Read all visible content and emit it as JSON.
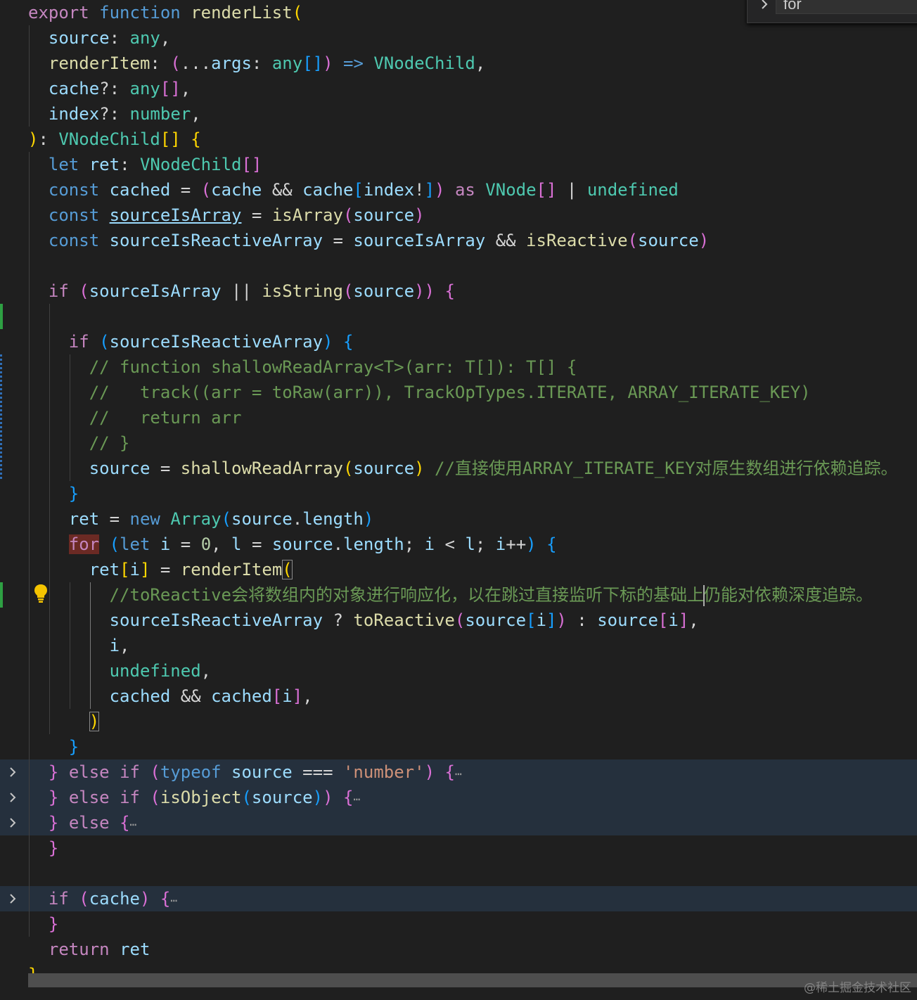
{
  "find_widget": {
    "value": "for"
  },
  "watermark": "@稀土掘金技术社区",
  "lines": [
    [
      [
        "kw",
        "export"
      ],
      [
        "pl",
        " "
      ],
      [
        "kwb",
        "function"
      ],
      [
        "pl",
        " "
      ],
      [
        "fn",
        "renderList"
      ],
      [
        "b1",
        "("
      ]
    ],
    [
      [
        "pl",
        "  "
      ],
      [
        "var",
        "source"
      ],
      [
        "pl",
        ": "
      ],
      [
        "typ",
        "any"
      ],
      [
        "pl",
        ","
      ]
    ],
    [
      [
        "pl",
        "  "
      ],
      [
        "fn",
        "renderItem"
      ],
      [
        "pl",
        ": "
      ],
      [
        "b2",
        "("
      ],
      [
        "pl",
        "..."
      ],
      [
        "var",
        "args"
      ],
      [
        "pl",
        ": "
      ],
      [
        "typ",
        "any"
      ],
      [
        "b3",
        "[]"
      ],
      [
        "b2",
        ")"
      ],
      [
        "pl",
        " "
      ],
      [
        "kwb",
        "=>"
      ],
      [
        "pl",
        " "
      ],
      [
        "typ",
        "VNodeChild"
      ],
      [
        "pl",
        ","
      ]
    ],
    [
      [
        "pl",
        "  "
      ],
      [
        "var",
        "cache"
      ],
      [
        "pl",
        "?: "
      ],
      [
        "typ",
        "any"
      ],
      [
        "b2",
        "[]"
      ],
      [
        "pl",
        ","
      ]
    ],
    [
      [
        "pl",
        "  "
      ],
      [
        "var",
        "index"
      ],
      [
        "pl",
        "?: "
      ],
      [
        "typ",
        "number"
      ],
      [
        "pl",
        ","
      ]
    ],
    [
      [
        "b1",
        ")"
      ],
      [
        "pl",
        ": "
      ],
      [
        "typ",
        "VNodeChild"
      ],
      [
        "b1",
        "[]"
      ],
      [
        "pl",
        " "
      ],
      [
        "b1",
        "{"
      ]
    ],
    [
      [
        "pl",
        "  "
      ],
      [
        "kwb",
        "let"
      ],
      [
        "pl",
        " "
      ],
      [
        "var",
        "ret"
      ],
      [
        "pl",
        ": "
      ],
      [
        "typ",
        "VNodeChild"
      ],
      [
        "b2",
        "[]"
      ]
    ],
    [
      [
        "pl",
        "  "
      ],
      [
        "kwb",
        "const"
      ],
      [
        "pl",
        " "
      ],
      [
        "var",
        "cached"
      ],
      [
        "pl",
        " = "
      ],
      [
        "b2",
        "("
      ],
      [
        "var",
        "cache"
      ],
      [
        "pl",
        " && "
      ],
      [
        "var",
        "cache"
      ],
      [
        "b3",
        "["
      ],
      [
        "var",
        "index"
      ],
      [
        "pl",
        "!"
      ],
      [
        "b3",
        "]"
      ],
      [
        "b2",
        ")"
      ],
      [
        "pl",
        " "
      ],
      [
        "kw",
        "as"
      ],
      [
        "pl",
        " "
      ],
      [
        "typ",
        "VNode"
      ],
      [
        "b2",
        "[]"
      ],
      [
        "pl",
        " | "
      ],
      [
        "typ",
        "undefined"
      ]
    ],
    [
      [
        "pl",
        "  "
      ],
      [
        "kwb",
        "const"
      ],
      [
        "pl",
        " "
      ],
      [
        "var ul",
        "sourceIsArray"
      ],
      [
        "pl",
        " = "
      ],
      [
        "fn",
        "isArray"
      ],
      [
        "b2",
        "("
      ],
      [
        "var",
        "source"
      ],
      [
        "b2",
        ")"
      ]
    ],
    [
      [
        "pl",
        "  "
      ],
      [
        "kwb",
        "const"
      ],
      [
        "pl",
        " "
      ],
      [
        "var",
        "sourceIsReactiveArray"
      ],
      [
        "pl",
        " = "
      ],
      [
        "var",
        "sourceIsArray"
      ],
      [
        "pl",
        " && "
      ],
      [
        "fn",
        "isReactive"
      ],
      [
        "b2",
        "("
      ],
      [
        "var",
        "source"
      ],
      [
        "b2",
        ")"
      ]
    ],
    [],
    [
      [
        "pl",
        "  "
      ],
      [
        "kw",
        "if"
      ],
      [
        "pl",
        " "
      ],
      [
        "b2",
        "("
      ],
      [
        "var",
        "sourceIsArray"
      ],
      [
        "pl",
        " || "
      ],
      [
        "fn",
        "isString"
      ],
      [
        "b2",
        "("
      ],
      [
        "var",
        "source"
      ],
      [
        "b2",
        "))"
      ],
      [
        "pl",
        " "
      ],
      [
        "b2",
        "{"
      ]
    ],
    [],
    [
      [
        "pl",
        "    "
      ],
      [
        "kw",
        "if"
      ],
      [
        "pl",
        " "
      ],
      [
        "b3",
        "("
      ],
      [
        "var",
        "sourceIsReactiveArray"
      ],
      [
        "b3",
        ")"
      ],
      [
        "pl",
        " "
      ],
      [
        "b3",
        "{"
      ]
    ],
    [
      [
        "pl",
        "      "
      ],
      [
        "cmt",
        "// function shallowReadArray<T>(arr: T[]): T[] {"
      ]
    ],
    [
      [
        "pl",
        "      "
      ],
      [
        "cmt",
        "//   track((arr = toRaw(arr)), TrackOpTypes.ITERATE, ARRAY_ITERATE_KEY)"
      ]
    ],
    [
      [
        "pl",
        "      "
      ],
      [
        "cmt",
        "//   return arr"
      ]
    ],
    [
      [
        "pl",
        "      "
      ],
      [
        "cmt",
        "// }"
      ]
    ],
    [
      [
        "pl",
        "      "
      ],
      [
        "var",
        "source"
      ],
      [
        "pl",
        " = "
      ],
      [
        "fn",
        "shallowReadArray"
      ],
      [
        "b1",
        "("
      ],
      [
        "var",
        "source"
      ],
      [
        "b1",
        ")"
      ],
      [
        "pl",
        " "
      ],
      [
        "cmt",
        "//直接使用ARRAY_ITERATE_KEY对原生数组进行依赖追踪。"
      ]
    ],
    [
      [
        "pl",
        "    "
      ],
      [
        "b3",
        "}"
      ]
    ],
    [
      [
        "pl",
        "    "
      ],
      [
        "var",
        "ret"
      ],
      [
        "pl",
        " = "
      ],
      [
        "kwb",
        "new"
      ],
      [
        "pl",
        " "
      ],
      [
        "typ",
        "Array"
      ],
      [
        "b3",
        "("
      ],
      [
        "var",
        "source"
      ],
      [
        "pl",
        "."
      ],
      [
        "var",
        "length"
      ],
      [
        "b3",
        ")"
      ]
    ],
    [
      [
        "pl",
        "    "
      ],
      [
        "kw hl-for",
        "for"
      ],
      [
        "pl",
        " "
      ],
      [
        "b3",
        "("
      ],
      [
        "kwb",
        "let"
      ],
      [
        "pl",
        " "
      ],
      [
        "var",
        "i"
      ],
      [
        "pl",
        " = "
      ],
      [
        "num",
        "0"
      ],
      [
        "pl",
        ", "
      ],
      [
        "var",
        "l"
      ],
      [
        "pl",
        " = "
      ],
      [
        "var",
        "source"
      ],
      [
        "pl",
        "."
      ],
      [
        "var",
        "length"
      ],
      [
        "pl",
        "; "
      ],
      [
        "var",
        "i"
      ],
      [
        "pl",
        " < "
      ],
      [
        "var",
        "l"
      ],
      [
        "pl",
        "; "
      ],
      [
        "var",
        "i"
      ],
      [
        "pl",
        "++"
      ],
      [
        "b3",
        ")"
      ],
      [
        "pl",
        " "
      ],
      [
        "b3",
        "{"
      ]
    ],
    [
      [
        "pl",
        "      "
      ],
      [
        "var",
        "ret"
      ],
      [
        "b1",
        "["
      ],
      [
        "var",
        "i"
      ],
      [
        "b1",
        "]"
      ],
      [
        "pl",
        " = "
      ],
      [
        "fn",
        "renderItem"
      ],
      [
        "b1 bracket-box",
        "("
      ]
    ],
    [
      [
        "pl",
        "        "
      ],
      [
        "cmt",
        "//toReactive会将数组内的对象进行响应化，以在跳过直接监听下标的基础上"
      ],
      [
        "caret",
        ""
      ],
      [
        "cmt",
        "仍能对依赖深度追踪。"
      ]
    ],
    [
      [
        "pl",
        "        "
      ],
      [
        "var",
        "sourceIsReactiveArray"
      ],
      [
        "pl",
        " ? "
      ],
      [
        "fn",
        "toReactive"
      ],
      [
        "b2",
        "("
      ],
      [
        "var",
        "source"
      ],
      [
        "b3",
        "["
      ],
      [
        "var",
        "i"
      ],
      [
        "b3",
        "]"
      ],
      [
        "b2",
        ")"
      ],
      [
        "pl",
        " : "
      ],
      [
        "var",
        "source"
      ],
      [
        "b2",
        "["
      ],
      [
        "var",
        "i"
      ],
      [
        "b2",
        "]"
      ],
      [
        "pl",
        ","
      ]
    ],
    [
      [
        "pl",
        "        "
      ],
      [
        "var",
        "i"
      ],
      [
        "pl",
        ","
      ]
    ],
    [
      [
        "pl",
        "        "
      ],
      [
        "typ",
        "undefined"
      ],
      [
        "pl",
        ","
      ]
    ],
    [
      [
        "pl",
        "        "
      ],
      [
        "var",
        "cached"
      ],
      [
        "pl",
        " && "
      ],
      [
        "var",
        "cached"
      ],
      [
        "b2",
        "["
      ],
      [
        "var",
        "i"
      ],
      [
        "b2",
        "]"
      ],
      [
        "pl",
        ","
      ]
    ],
    [
      [
        "pl",
        "      "
      ],
      [
        "b1 bracket-box",
        ")"
      ]
    ],
    [
      [
        "pl",
        "    "
      ],
      [
        "b3",
        "}"
      ]
    ],
    [
      [
        "pl",
        "  "
      ],
      [
        "b2",
        "}"
      ],
      [
        "pl",
        " "
      ],
      [
        "kw",
        "else"
      ],
      [
        "pl",
        " "
      ],
      [
        "kw",
        "if"
      ],
      [
        "pl",
        " "
      ],
      [
        "b2",
        "("
      ],
      [
        "kwb",
        "typeof"
      ],
      [
        "pl",
        " "
      ],
      [
        "var",
        "source"
      ],
      [
        "pl",
        " === "
      ],
      [
        "str",
        "'number'"
      ],
      [
        "b2",
        ")"
      ],
      [
        "pl",
        " "
      ],
      [
        "b2",
        "{"
      ],
      [
        "ell",
        "⋯"
      ]
    ],
    [
      [
        "pl",
        "  "
      ],
      [
        "b2",
        "}"
      ],
      [
        "pl",
        " "
      ],
      [
        "kw",
        "else"
      ],
      [
        "pl",
        " "
      ],
      [
        "kw",
        "if"
      ],
      [
        "pl",
        " "
      ],
      [
        "b2",
        "("
      ],
      [
        "fn",
        "isObject"
      ],
      [
        "b3",
        "("
      ],
      [
        "var",
        "source"
      ],
      [
        "b3",
        ")"
      ],
      [
        "b2",
        ")"
      ],
      [
        "pl",
        " "
      ],
      [
        "b2",
        "{"
      ],
      [
        "ell",
        "⋯"
      ]
    ],
    [
      [
        "pl",
        "  "
      ],
      [
        "b2",
        "}"
      ],
      [
        "pl",
        " "
      ],
      [
        "kw",
        "else"
      ],
      [
        "pl",
        " "
      ],
      [
        "b2",
        "{"
      ],
      [
        "ell",
        "⋯"
      ]
    ],
    [
      [
        "pl",
        "  "
      ],
      [
        "b2",
        "}"
      ]
    ],
    [],
    [
      [
        "pl",
        "  "
      ],
      [
        "kw",
        "if"
      ],
      [
        "pl",
        " "
      ],
      [
        "b2",
        "("
      ],
      [
        "var",
        "cache"
      ],
      [
        "b2",
        ")"
      ],
      [
        "pl",
        " "
      ],
      [
        "b2",
        "{"
      ],
      [
        "ell",
        "⋯"
      ]
    ],
    [
      [
        "pl",
        "  "
      ],
      [
        "b2",
        "}"
      ]
    ],
    [
      [
        "pl",
        "  "
      ],
      [
        "kw",
        "return"
      ],
      [
        "pl",
        " "
      ],
      [
        "var",
        "ret"
      ]
    ],
    [
      [
        "b1",
        "}"
      ]
    ]
  ]
}
